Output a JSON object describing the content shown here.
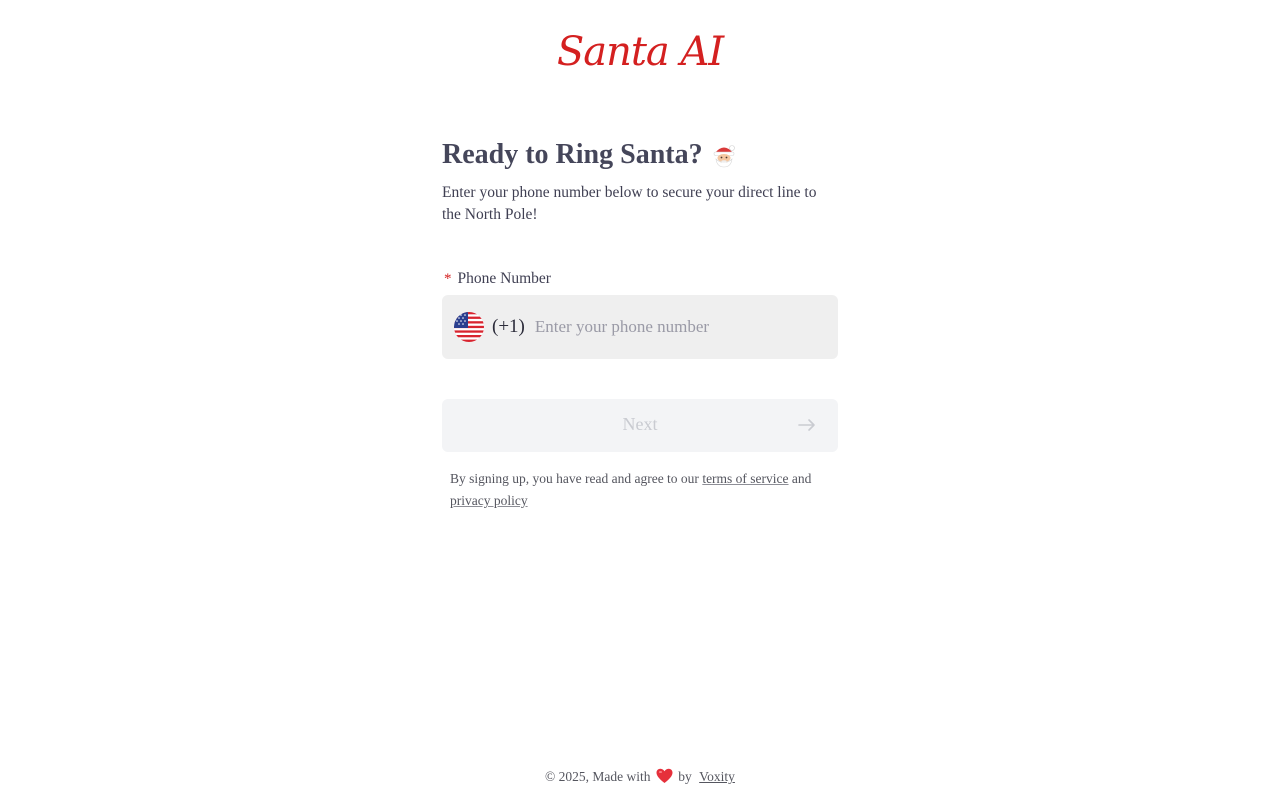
{
  "brand": {
    "logo_text": "Santa AI",
    "logo_color": "#d42020"
  },
  "signup": {
    "title": "Ready to Ring Santa?",
    "title_icon": "santa-face-icon",
    "subtitle": "Enter your phone number below to secure your direct line to the North Pole!",
    "phone_field": {
      "required_mark": "*",
      "label": "Phone Number",
      "country_flag_icon": "us-flag-icon",
      "dial_code": "(+1)",
      "placeholder": "Enter your phone number",
      "value": ""
    },
    "next_button": {
      "label": "Next",
      "icon": "arrow-right-icon",
      "state": "disabled"
    },
    "terms": {
      "prefix": "By signing up, you have read and agree to our",
      "terms_link": "terms of service",
      "conjunction": "and",
      "privacy_link": "privacy policy"
    }
  },
  "footer": {
    "prefix": "© 2025, Made with",
    "heart_icon": "heart-icon",
    "by": "by",
    "company_link": "Voxity"
  }
}
